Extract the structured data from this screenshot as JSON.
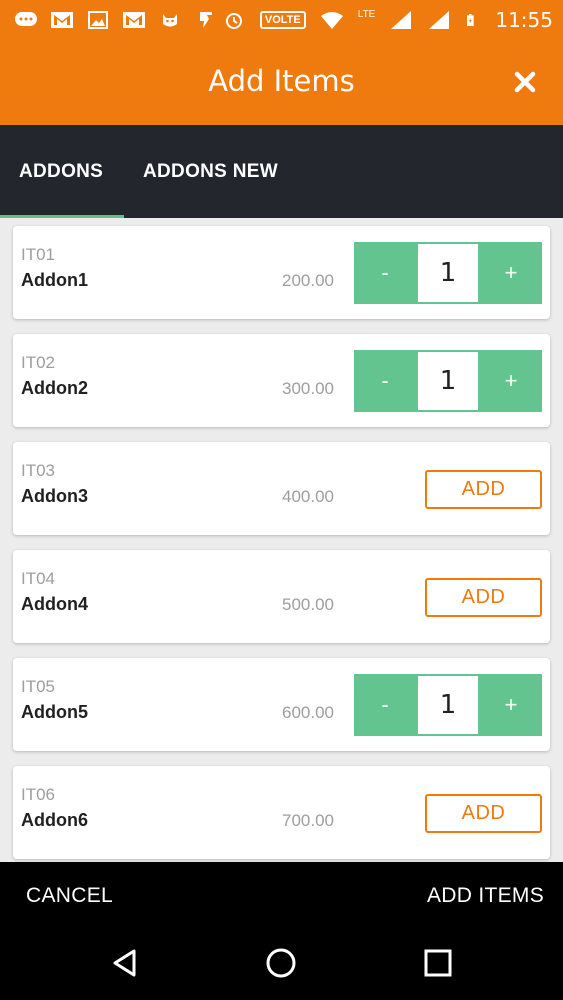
{
  "status_bar": {
    "time": "11:55",
    "network_badge": "VOLTE",
    "lte_label": "LTE",
    "icons": [
      "message-icon",
      "gmail-icon",
      "image-icon",
      "gmail-icon",
      "cat-icon",
      "flash-icon",
      "alarm-icon",
      "volte-icon",
      "wifi-icon",
      "lte-icon",
      "signal-icon",
      "signal-icon",
      "battery-icon"
    ]
  },
  "header": {
    "title": "Add Items",
    "close_icon": "close-icon"
  },
  "tabs": [
    {
      "label": "ADDONS",
      "active": true
    },
    {
      "label": "ADDONS NEW",
      "active": false
    }
  ],
  "items": [
    {
      "code": "IT01",
      "name": "Addon1",
      "price": "200.00",
      "state": "stepper",
      "qty": "1"
    },
    {
      "code": "IT02",
      "name": "Addon2",
      "price": "300.00",
      "state": "stepper",
      "qty": "1"
    },
    {
      "code": "IT03",
      "name": "Addon3",
      "price": "400.00",
      "state": "add",
      "add_label": "ADD"
    },
    {
      "code": "IT04",
      "name": "Addon4",
      "price": "500.00",
      "state": "add",
      "add_label": "ADD"
    },
    {
      "code": "IT05",
      "name": "Addon5",
      "price": "600.00",
      "state": "stepper",
      "qty": "1"
    },
    {
      "code": "IT06",
      "name": "Addon6",
      "price": "700.00",
      "state": "add",
      "add_label": "ADD"
    }
  ],
  "stepper": {
    "minus": "-",
    "plus": "+"
  },
  "actions": {
    "cancel": "CANCEL",
    "add_items": "ADD ITEMS"
  },
  "colors": {
    "accent": "#ef7a0e",
    "tab_bar": "#23262d",
    "stepper_green": "#64c490",
    "tab_indicator": "#5fc08c"
  }
}
